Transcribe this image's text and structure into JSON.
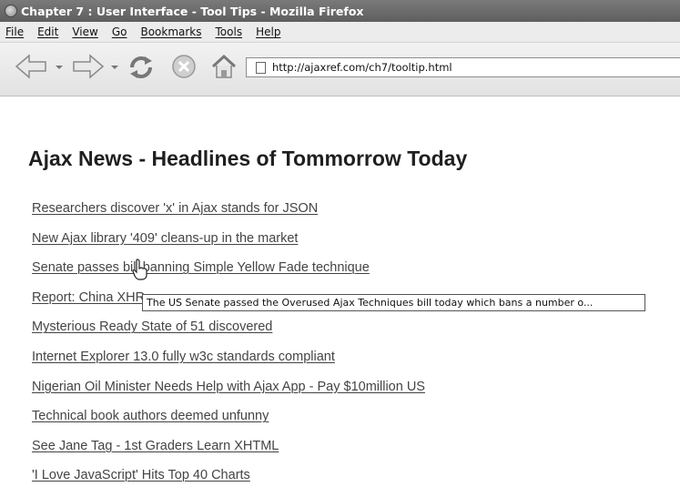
{
  "window": {
    "title": "Chapter 7 : User Interface - Tool Tips - Mozilla Firefox"
  },
  "menu": {
    "items": [
      "File",
      "Edit",
      "View",
      "Go",
      "Bookmarks",
      "Tools",
      "Help"
    ]
  },
  "toolbar": {
    "url": "http://ajaxref.com/ch7/tooltip.html",
    "icons": [
      "back-arrow-icon",
      "forward-arrow-icon",
      "reload-icon",
      "stop-icon",
      "home-icon",
      "page-icon"
    ]
  },
  "page": {
    "headline": "Ajax News - Headlines of Tommorrow Today",
    "links": [
      "Researchers discover 'x' in Ajax stands for JSON",
      "New Ajax library '409' cleans-up in the market",
      "Senate passes bill banning Simple Yellow Fade technique",
      "Report: China XHR",
      "Mysterious Ready State of 51 discovered",
      "Internet Explorer 13.0 fully w3c standards compliant",
      "Nigerian Oil Minister Needs Help with Ajax App - Pay $10million US",
      "Technical book authors deemed unfunny",
      "See Jane Tag - 1st Graders Learn XHTML",
      "'I Love JavaScript' Hits Top 40 Charts"
    ],
    "tooltip": "The US Senate passed the Overused Ajax Techniques bill today which bans a number o..."
  },
  "colors": {
    "title_bar": "#6b6b6b",
    "menu_bar": "#ececec",
    "link_text": "#444444"
  }
}
